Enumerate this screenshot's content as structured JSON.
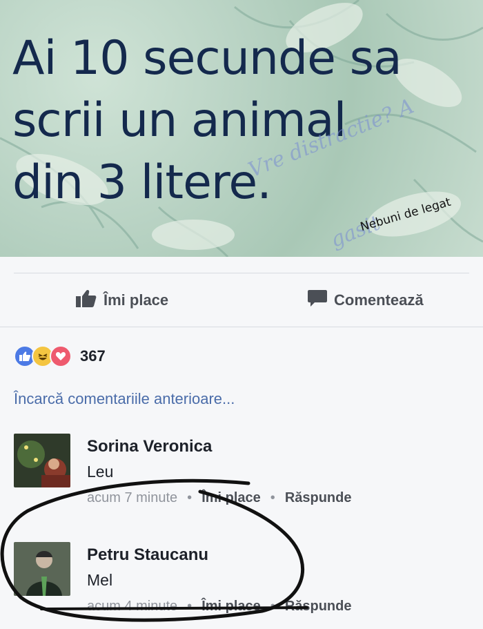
{
  "post": {
    "headline_lines": [
      "Ai 10 secunde sa",
      "scrii un animal",
      "din 3 litere."
    ],
    "watermark_line1": "Vre distractie? A",
    "watermark_line2": "gasit",
    "page_tag": "Nebuni de legat"
  },
  "actions": {
    "like_label": "Îmi place",
    "comment_label": "Comentează"
  },
  "reactions": {
    "icons": [
      "like-icon",
      "haha-icon",
      "love-icon"
    ],
    "count": "367"
  },
  "load_more": "Încarcă comentariile anterioare...",
  "comments": [
    {
      "author": "Sorina Veronica",
      "text": "Leu",
      "time": "acum 7 minute",
      "like": "Îmi place",
      "reply": "Răspunde"
    },
    {
      "author": "Petru Staucanu",
      "text": "Mel",
      "time": "acum 4 minute",
      "like": "Îmi place",
      "reply": "Răspunde"
    }
  ],
  "meta_separator": "•",
  "colors": {
    "link_blue": "#4a6ca9",
    "text_dark": "#1d2129",
    "meta_grey": "#90949c",
    "headline_navy": "#14294d"
  }
}
